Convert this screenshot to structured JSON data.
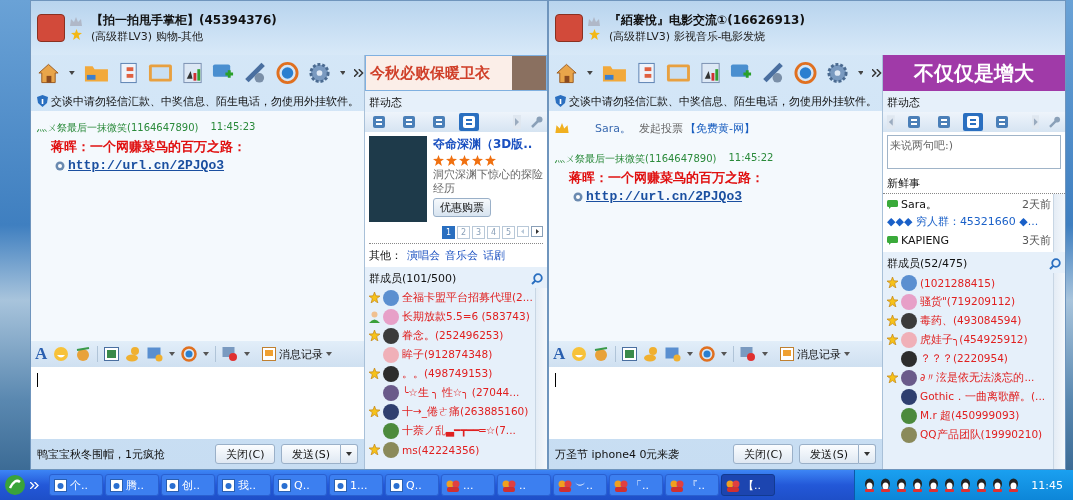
{
  "windows": [
    {
      "title": "【拍一拍甩手掌柜】(45394376)",
      "subtitle": "(高级群LV3) 购物-其他",
      "notice": "交谈中请勿轻信汇款、中奖信息、陌生电话，勿使用外挂软件。",
      "messages": [
        {
          "kind": "chat",
          "sender": "灬ㄨ祭最后一抹微笑(1164647890)",
          "time": "11:45:23",
          "text": "蒋晖：一个网赚菜鸟的百万之路：",
          "link": "http://url.cn/2PJQo3"
        }
      ],
      "font_button": "A",
      "history_button": "消息记录",
      "footer_text": "鸭宝宝秋冬围帽，1元疯抢",
      "close_button": "关闭(C)",
      "send_button": "发送(S)",
      "side": {
        "kind": "movie",
        "banner": {
          "kind": "photo",
          "text": "今秋必败保暖卫衣"
        },
        "section_title": "群动态",
        "tabs": [
          {
            "selected": false
          },
          {
            "selected": false
          },
          {
            "selected": false
          },
          {
            "selected": true
          }
        ],
        "movie": {
          "title": "夺命深渊（3D版..",
          "stars": 5,
          "description": "洞穴深渊下惊心的探险经历",
          "button": "优惠购票",
          "pages": [
            {
              "label": "1",
              "selected": true
            },
            {
              "label": "2",
              "selected": false
            },
            {
              "label": "3",
              "selected": false
            },
            {
              "label": "4",
              "selected": false
            },
            {
              "label": "5",
              "selected": false
            }
          ]
        },
        "others_label": "其他：",
        "others_links": [
          "演唱会",
          "音乐会",
          "话剧"
        ]
      },
      "members": {
        "title": "群成员(101/500)",
        "items": [
          {
            "kind": "admin",
            "name": "全福卡盟平台招募代理(2..."
          },
          {
            "kind": "user",
            "name": "长期放款5.5=6 (583743)"
          },
          {
            "kind": "admin",
            "name": "眷念。(252496253)"
          },
          {
            "kind": "member",
            "name": "眸子(912874348)"
          },
          {
            "kind": "admin",
            "name": "。。(498749153)"
          },
          {
            "kind": "member",
            "name": "╰☆生 ╮ 性☆╮ (27044..."
          },
          {
            "kind": "admin",
            "name": "十→_倦ㄜ痛(263885160)"
          },
          {
            "kind": "member",
            "name": "十萘ノ乱▃━┳━━═☆(7..."
          },
          {
            "kind": "admin",
            "name": "ms(42224356)"
          }
        ]
      }
    },
    {
      "title": "『絔褰悅』电影交流①(16626913)",
      "subtitle": "(高级群LV3) 影视音乐-电影发烧",
      "notice": "交谈中请勿轻信汇款、中奖信息、陌生电话，勿使用外挂软件。",
      "messages": [
        {
          "kind": "vote",
          "user": "Sara。",
          "text": "发起投票",
          "link": "【免费黄-网】"
        },
        {
          "kind": "chat",
          "sender": "灬ㄨ祭最后一抹微笑(1164647890)",
          "time": "11:45:22",
          "text": "蒋晖：一个网赚菜鸟的百万之路：",
          "link": "http://url.cn/2PJQo3"
        }
      ],
      "font_button": "A",
      "history_button": "消息记录",
      "footer_text": "万圣节 iphone4 0元来袭",
      "close_button": "关闭(C)",
      "send_button": "发送(S)",
      "side": {
        "kind": "feed",
        "banner": {
          "kind": "text",
          "text": "不仅仅是增大"
        },
        "section_title": "群动态",
        "tabs": [
          {
            "selected": false
          },
          {
            "selected": false
          },
          {
            "selected": true
          },
          {
            "selected": false
          }
        ],
        "comment_placeholder": "来说两句吧:)",
        "feed_title": "新鲜事",
        "feed": [
          {
            "author": "Sara。",
            "time": "2天前",
            "text": "◆◆◆ 穷人群：45321660 ◆..."
          },
          {
            "author": "KAPIENG",
            "time": "3天前"
          }
        ]
      },
      "members": {
        "title": "群成员(52/475)",
        "items": [
          {
            "kind": "admin",
            "name": "(1021288415)"
          },
          {
            "kind": "admin",
            "name": "骚货\"(719209112)"
          },
          {
            "kind": "admin",
            "name": "毒药、(493084594)"
          },
          {
            "kind": "admin",
            "name": "虎娃子╮(454925912)"
          },
          {
            "kind": "member",
            "name": "？？？(2220954)"
          },
          {
            "kind": "admin",
            "name": "∂〃泫是依无法淡忘的..."
          },
          {
            "kind": "member",
            "name": "Gothic．一曲离歌醉。(..."
          },
          {
            "kind": "member",
            "name": "M.r 超(450999093)"
          },
          {
            "kind": "member",
            "name": "QQ产品团队(19990210)"
          }
        ]
      }
    }
  ],
  "taskbar": {
    "items": [
      {
        "kind": "window",
        "label": "个..",
        "selected": false
      },
      {
        "kind": "window",
        "label": "腾..",
        "selected": false
      },
      {
        "kind": "window",
        "label": "创..",
        "selected": false
      },
      {
        "kind": "window",
        "label": "我..",
        "selected": false
      },
      {
        "kind": "window",
        "label": "Q..",
        "selected": false
      },
      {
        "kind": "window",
        "label": "1...",
        "selected": false
      },
      {
        "kind": "window",
        "label": "Q..",
        "selected": false
      },
      {
        "kind": "group",
        "label": "...",
        "selected": false
      },
      {
        "kind": "group",
        "label": "..",
        "selected": false
      },
      {
        "kind": "group",
        "label": "︶..",
        "selected": false
      },
      {
        "kind": "group",
        "label": "「..",
        "selected": false
      },
      {
        "kind": "group",
        "label": "『..",
        "selected": false
      },
      {
        "kind": "group",
        "label": "【..",
        "selected": true
      }
    ],
    "clock": "11:45"
  }
}
